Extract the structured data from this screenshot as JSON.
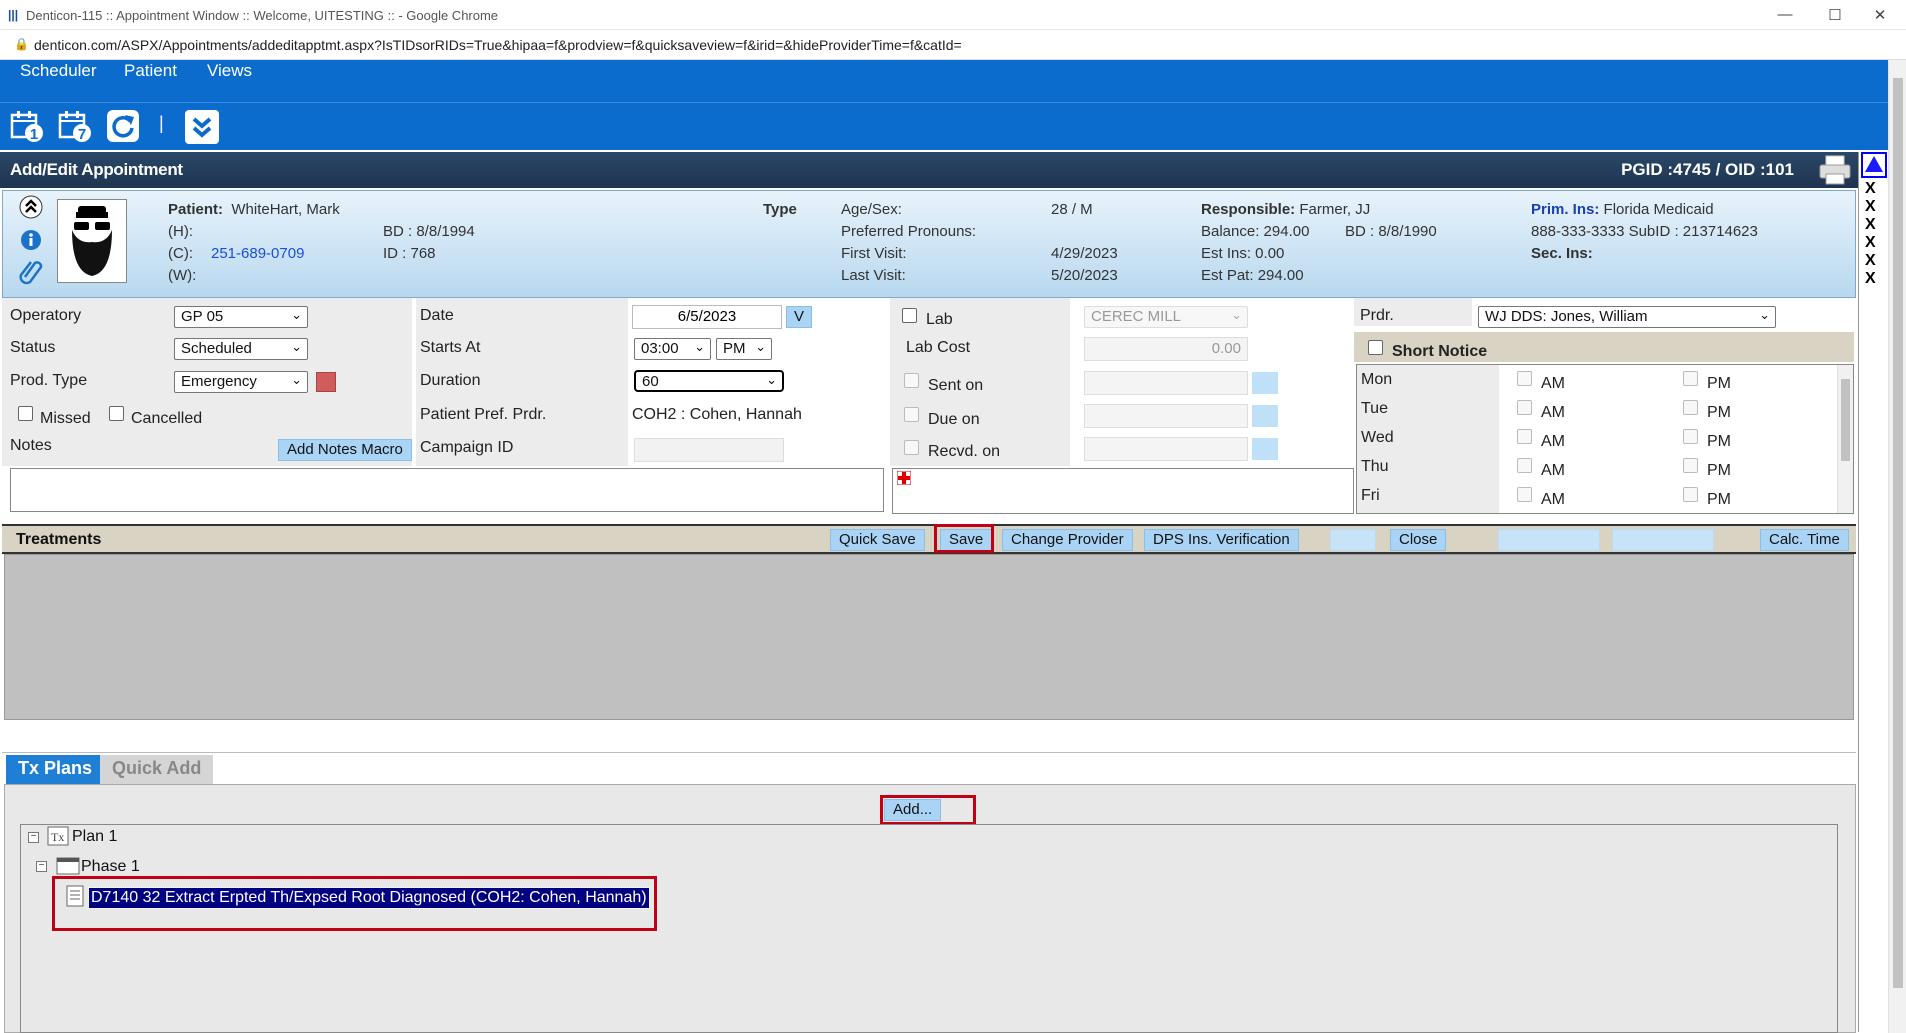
{
  "browser": {
    "title": "Denticon-115 :: Appointment Window :: Welcome, UITESTING :: - Google Chrome",
    "url": "denticon.com/ASPX/Appointments/addeditapptmt.aspx?IsTIDsorRIDs=True&hipaa=f&prodview=f&quicksaveview=f&irid=&hideProviderTime=f&catId=",
    "controls": {
      "minimize": "—",
      "maximize": "☐",
      "close": "✕"
    }
  },
  "menu": [
    "Scheduler",
    "Patient",
    "Views"
  ],
  "toolbar": {
    "icons": [
      "calendar-day-icon",
      "calendar-week-icon",
      "refresh-icon",
      "collapse-down-icon"
    ],
    "cal1": "1",
    "cal7": "7",
    "separator": "|"
  },
  "header": {
    "title": "Add/Edit Appointment",
    "pgid": "PGID :4745  /  OID :101"
  },
  "side_x": [
    "X",
    "X",
    "X",
    "X",
    "X",
    "X"
  ],
  "patient": {
    "patient_label": "Patient:",
    "name": "WhiteHart, Mark",
    "h_label": "(H):",
    "c_label": "(C):",
    "c_phone": "251-689-0709",
    "w_label": "(W):",
    "bd": "BD : 8/8/1994",
    "id": "ID : 768",
    "type_label": "Type",
    "age_sex_label": "Age/Sex:",
    "age_sex": "28 / M",
    "pronouns_label": "Preferred Pronouns:",
    "first_visit_label": "First Visit:",
    "first_visit": "4/29/2023",
    "last_visit_label": "Last Visit:",
    "last_visit": "5/20/2023",
    "responsible_label": "Responsible:",
    "responsible": "Farmer, JJ",
    "balance": "Balance: 294.00",
    "resp_bd": "BD : 8/8/1990",
    "est_ins": "Est Ins:  0.00",
    "est_pat": "Est Pat: 294.00",
    "prim_ins_label": "Prim. Ins:",
    "prim_ins": "Florida Medicaid",
    "ins_phone": "888-333-3333 SubID : 213714623",
    "sec_ins_label": "Sec. Ins:"
  },
  "form": {
    "operatory_label": "Operatory",
    "operatory": "GP 05",
    "status_label": "Status",
    "status": "Scheduled",
    "prod_type_label": "Prod. Type",
    "prod_type": "Emergency",
    "missed_label": "Missed",
    "cancelled_label": "Cancelled",
    "notes_label": "Notes",
    "add_notes_macro": "Add Notes Macro",
    "date_label": "Date",
    "date": "6/5/2023",
    "date_btn": "V",
    "starts_at_label": "Starts At",
    "starts_time": "03:00",
    "starts_ampm": "PM",
    "duration_label": "Duration",
    "duration": "60",
    "pref_prdr_label": "Patient Pref. Prdr.",
    "pref_prdr": "COH2 : Cohen, Hannah",
    "campaign_label": "Campaign ID",
    "lab_label": "Lab",
    "lab_value": "CEREC MILL",
    "lab_cost_label": "Lab Cost",
    "lab_cost": "0.00",
    "sent_on_label": "Sent on",
    "due_on_label": "Due on",
    "recvd_on_label": "Recvd. on",
    "prdr_label": "Prdr.",
    "prdr": "WJ DDS: Jones, William",
    "short_notice_label": "Short Notice",
    "days": [
      {
        "day": "Mon",
        "am": "AM",
        "pm": "PM"
      },
      {
        "day": "Tue",
        "am": "AM",
        "pm": "PM"
      },
      {
        "day": "Wed",
        "am": "AM",
        "pm": "PM"
      },
      {
        "day": "Thu",
        "am": "AM",
        "pm": "PM"
      },
      {
        "day": "Fri",
        "am": "AM",
        "pm": "PM"
      }
    ]
  },
  "treatments": {
    "title": "Treatments",
    "quick_save": "Quick Save",
    "save": "Save",
    "change_provider": "Change Provider",
    "dps": "DPS Ins. Verification",
    "close": "Close",
    "calc_time": "Calc. Time"
  },
  "tabs": {
    "tx_plans": "Tx Plans",
    "quick_add": "Quick Add"
  },
  "txplan": {
    "add_button": "Add...",
    "plan": "Plan 1",
    "phase": "Phase 1",
    "procedure": "D7140 32 Extract Erpted Th/Expsed Root Diagnosed (COH2: Cohen, Hannah)"
  },
  "colors": {
    "menu_blue": "#0c6ccd",
    "header_navy": "#1e3450",
    "highlight_red": "#c00015",
    "selected_navy": "#000080",
    "prod_type_swatch": "#d05c5c"
  }
}
